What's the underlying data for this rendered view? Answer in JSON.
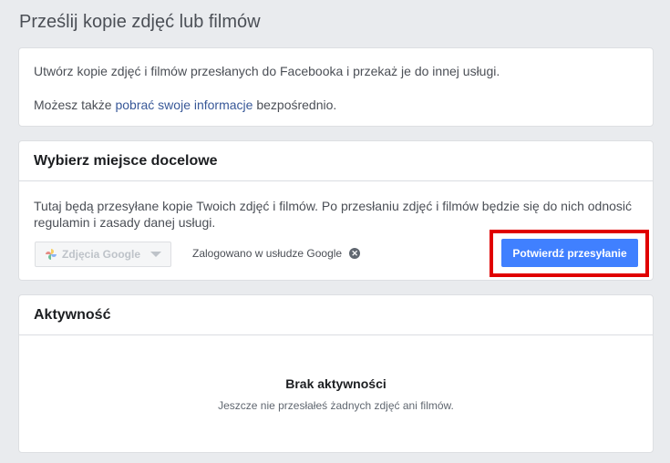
{
  "page": {
    "title": "Prześlij kopie zdjęć lub filmów"
  },
  "intro": {
    "line1": "Utwórz kopie zdjęć i filmów przesłanych do Facebooka i przekaż je do innej usługi.",
    "line2_prefix": "Możesz także ",
    "line2_link": "pobrać swoje informacje",
    "line2_suffix": " bezpośrednio."
  },
  "destination": {
    "header": "Wybierz miejsce docelowe",
    "description": "Tutaj będą przesyłane kopie Twoich zdjęć i filmów. Po przesłaniu zdjęć i filmów będzie się do nich odnosić regulamin i zasady danej usługi.",
    "select_value": "Zdjęcia Google",
    "select_icon": "google-photos-icon",
    "logged_in_text": "Zalogowano w usłudze Google",
    "confirm_label": "Potwierdź przesyłanie",
    "accent_color": "#4080ff",
    "highlight_color": "#e00000"
  },
  "activity": {
    "header": "Aktywność",
    "empty_title": "Brak aktywności",
    "empty_subtitle": "Jeszcze nie przesłałeś żadnych zdjęć ani filmów."
  }
}
